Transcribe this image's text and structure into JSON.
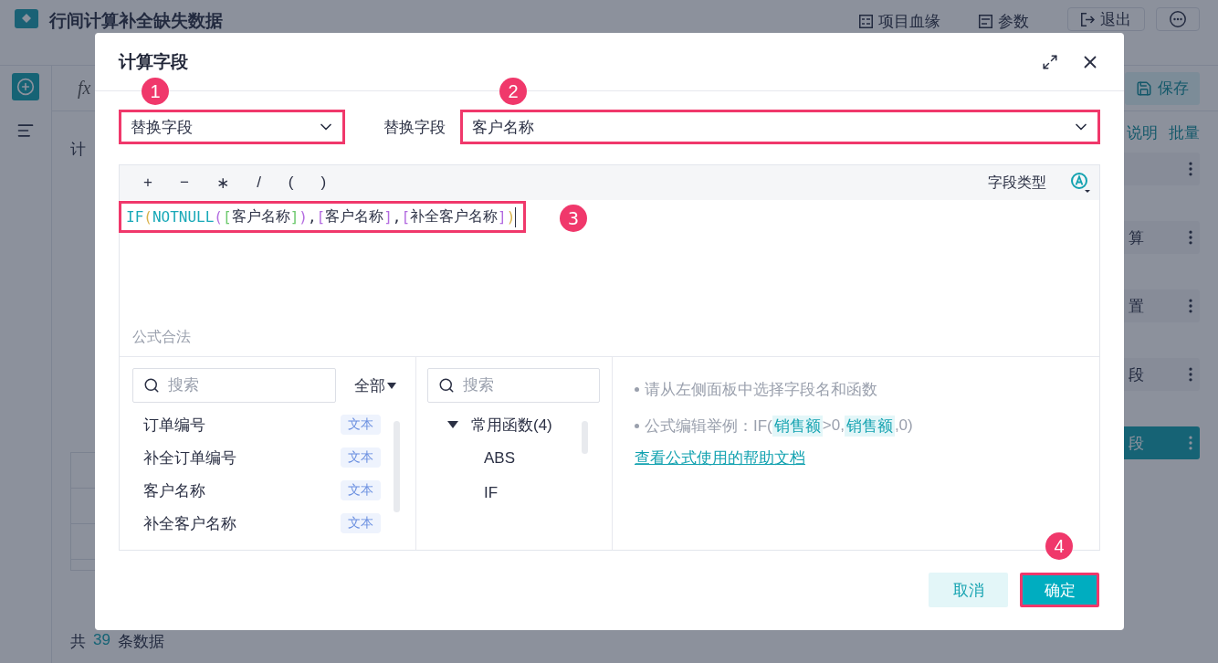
{
  "app": {
    "title": "行间计算补全缺失数据",
    "header_actions": [
      {
        "kind": "lineage",
        "label": "项目血缘"
      },
      {
        "kind": "params",
        "label": "参数"
      },
      {
        "kind": "exit",
        "label": "退出"
      },
      {
        "kind": "more"
      }
    ],
    "toolbar": {
      "formula_mark": "fx",
      "save": "保存"
    },
    "section_label": "计",
    "links": [
      "说明",
      "批量"
    ],
    "steps": [
      {
        "selected": false
      },
      {
        "label": "算",
        "selected": false
      },
      {
        "label": "置",
        "selected": false
      },
      {
        "label": "段",
        "selected": false
      },
      {
        "label": "段",
        "selected": true
      }
    ],
    "footer": {
      "prefix": "共",
      "count": "39",
      "suffix": "条数据"
    }
  },
  "dialog": {
    "title": "计算字段",
    "mode_select": {
      "value": "替换字段",
      "callout": "1"
    },
    "target_label": "替换字段",
    "target_select": {
      "value": "客户名称",
      "callout": "2"
    },
    "operators": [
      "+",
      "−",
      "∗",
      "/",
      "(",
      ")"
    ],
    "field_type_label": "字段类型",
    "formula": {
      "callout": "3",
      "tokens": [
        {
          "text": "IF",
          "color": "#1aa9b8"
        },
        {
          "text": "(",
          "color": "#d9b24a"
        },
        {
          "text": "NOTNULL",
          "color": "#1aa9b8"
        },
        {
          "text": "(",
          "color": "#b36be0"
        },
        {
          "text": "[",
          "color": "#6cc96c"
        },
        {
          "text": "客户名称",
          "color": "#2b3044"
        },
        {
          "text": "]",
          "color": "#6cc96c"
        },
        {
          "text": ")",
          "color": "#b36be0"
        },
        {
          "text": ",",
          "color": "#2b3044"
        },
        {
          "text": "[",
          "color": "#b36be0"
        },
        {
          "text": "客户名称",
          "color": "#2b3044"
        },
        {
          "text": "]",
          "color": "#b36be0"
        },
        {
          "text": ",",
          "color": "#2b3044"
        },
        {
          "text": "[",
          "color": "#b36be0"
        },
        {
          "text": "补全客户名称",
          "color": "#2b3044"
        },
        {
          "text": "]",
          "color": "#b36be0"
        },
        {
          "text": ")",
          "color": "#d9b24a"
        }
      ]
    },
    "status": "公式合法",
    "field_search": {
      "placeholder": "搜索"
    },
    "field_filter": "全部",
    "fields": [
      {
        "name": "订单编号",
        "type": "文本"
      },
      {
        "name": "补全订单编号",
        "type": "文本"
      },
      {
        "name": "客户名称",
        "type": "文本"
      },
      {
        "name": "补全客户名称",
        "type": "文本"
      }
    ],
    "function_search": {
      "placeholder": "搜索"
    },
    "functions": [
      {
        "label": "常用函数(4)",
        "expanded": true,
        "children": [
          {
            "label": "ABS"
          },
          {
            "label": "IF"
          }
        ]
      }
    ],
    "hints": [
      {
        "parts": [
          {
            "kind": "plain",
            "text": "请从左侧面板中选择字段名和函数"
          }
        ]
      },
      {
        "parts": [
          {
            "kind": "plain",
            "text": "公式编辑举例：IF("
          },
          {
            "kind": "field",
            "text": "销售额"
          },
          {
            "kind": "plain",
            "text": ">0,"
          },
          {
            "kind": "field",
            "text": "销售额"
          },
          {
            "kind": "plain",
            "text": ",0)"
          }
        ]
      }
    ],
    "help_link": "查看公式使用的帮助文档",
    "buttons": [
      {
        "kind": "secondary",
        "label": "取消"
      },
      {
        "kind": "primary",
        "label": "确定",
        "callout": "4"
      }
    ]
  }
}
